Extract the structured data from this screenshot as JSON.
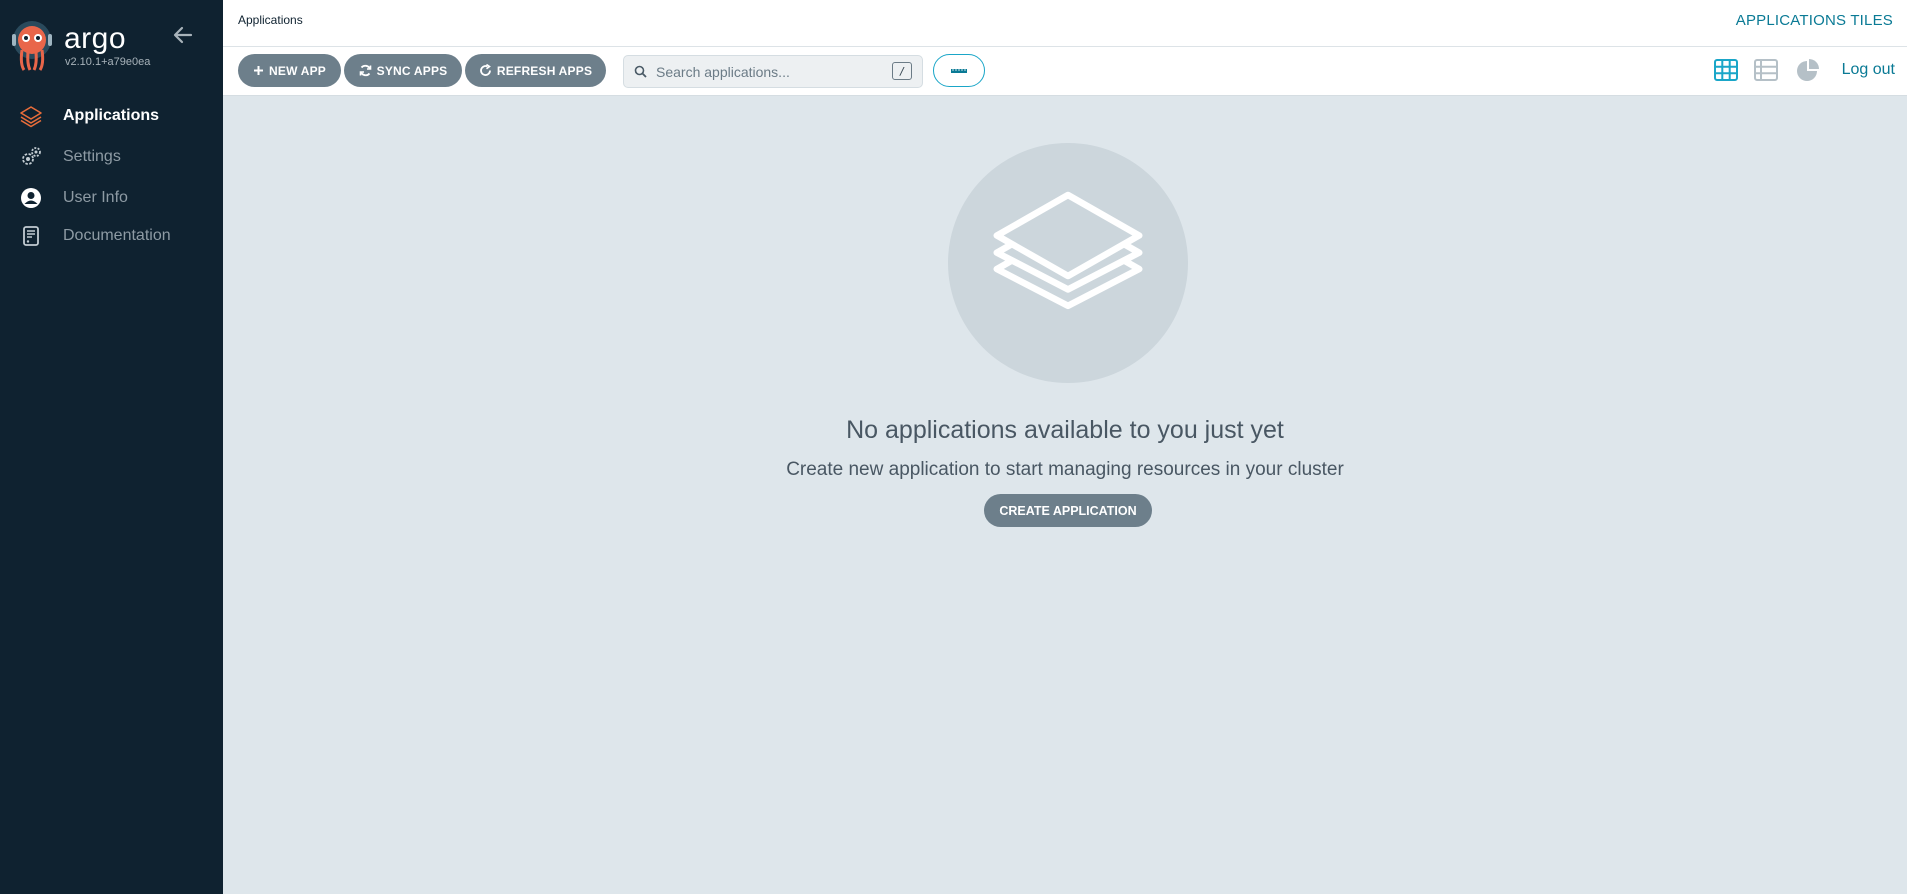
{
  "sidebar": {
    "brand": "argo",
    "version": "v2.10.1+a79e0ea",
    "items": [
      {
        "label": "Applications",
        "icon": "layers-icon",
        "active": true
      },
      {
        "label": "Settings",
        "icon": "gears-icon",
        "active": false
      },
      {
        "label": "User Info",
        "icon": "user-circle-icon",
        "active": false
      },
      {
        "label": "Documentation",
        "icon": "book-icon",
        "active": false
      }
    ]
  },
  "topbar": {
    "breadcrumb": "Applications",
    "title": "APPLICATIONS TILES"
  },
  "toolbar": {
    "new_app": "NEW APP",
    "sync_apps": "SYNC APPS",
    "refresh_apps": "REFRESH APPS",
    "search_placeholder": "Search applications...",
    "search_shortcut": "/",
    "logout": "Log out"
  },
  "empty_state": {
    "title": "No applications available to you just yet",
    "subtitle": "Create new application to start managing resources in your cluster",
    "button": "CREATE APPLICATION"
  },
  "colors": {
    "sidebar_bg": "#0f2230",
    "accent": "#0a7a95",
    "active_icon": "#e96d3a",
    "button_bg": "#6d7f8b",
    "content_bg": "#dee6eb"
  }
}
